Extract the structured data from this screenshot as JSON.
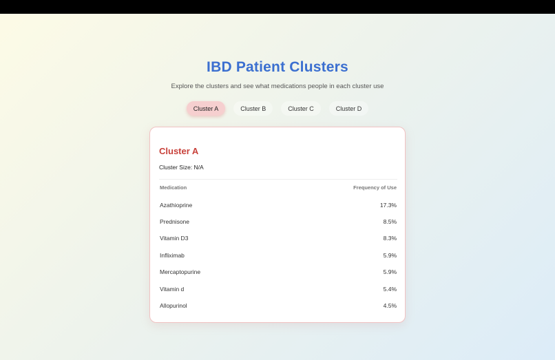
{
  "header": {
    "title": "IBD Patient Clusters",
    "subtitle": "Explore the clusters and see what medications people in each cluster use"
  },
  "tabs": [
    {
      "label": "Cluster A",
      "active": true
    },
    {
      "label": "Cluster B",
      "active": false
    },
    {
      "label": "Cluster C",
      "active": false
    },
    {
      "label": "Cluster D",
      "active": false
    }
  ],
  "card": {
    "title": "Cluster A",
    "cluster_size": "Cluster Size: N/A",
    "columns": {
      "medication": "Medication",
      "frequency": "Frequency of Use"
    },
    "rows": [
      {
        "medication": "Azathioprine",
        "frequency": "17.3%"
      },
      {
        "medication": "Prednisone",
        "frequency": "8.5%"
      },
      {
        "medication": "Vitamin D3",
        "frequency": "8.3%"
      },
      {
        "medication": "Infliximab",
        "frequency": "5.9%"
      },
      {
        "medication": "Mercaptopurine",
        "frequency": "5.9%"
      },
      {
        "medication": "Vitamin d",
        "frequency": "5.4%"
      },
      {
        "medication": "Allopurinol",
        "frequency": "4.5%"
      }
    ]
  },
  "colors": {
    "title": "#3b6fd0",
    "cluster_title": "#c8413a",
    "active_tab": "#f6cfcf"
  }
}
